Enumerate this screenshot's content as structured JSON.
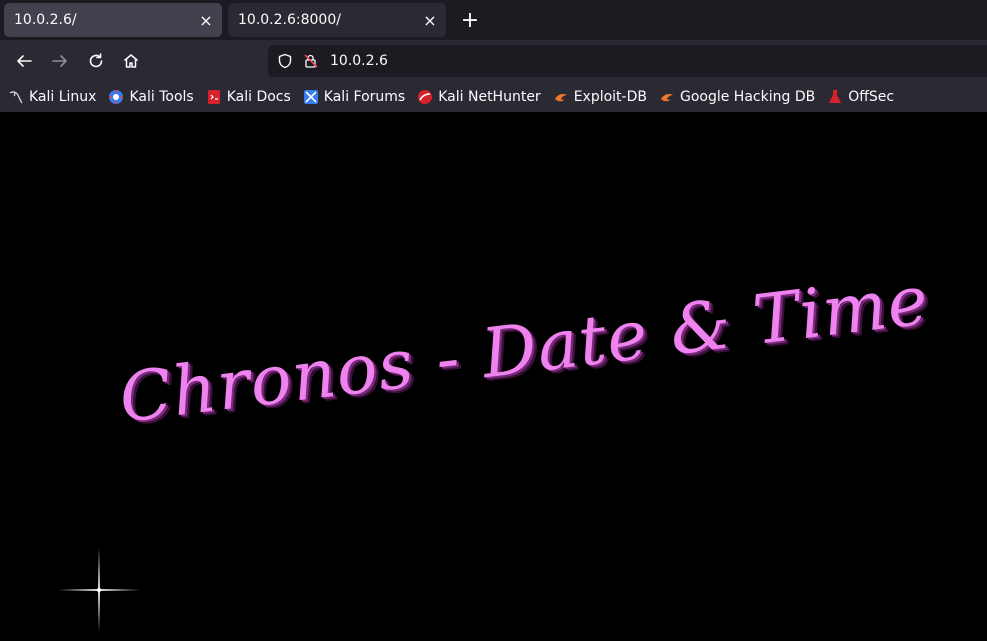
{
  "tabs": [
    {
      "title": "10.0.2.6/",
      "active": true
    },
    {
      "title": "10.0.2.6:8000/",
      "active": false
    }
  ],
  "new_tab_label": "+",
  "close_glyph": "×",
  "url": "10.0.2.6",
  "icons": {
    "back": "arrow-left-icon",
    "forward": "arrow-right-icon",
    "reload": "reload-icon",
    "home": "home-icon",
    "shield": "shield-icon",
    "insecure_lock": "lock-warning-icon"
  },
  "bookmarks": [
    {
      "label": "Kali Linux",
      "icon": "kali-dragon-icon"
    },
    {
      "label": "Kali Tools",
      "icon": "kali-tools-icon"
    },
    {
      "label": "Kali Docs",
      "icon": "kali-docs-icon"
    },
    {
      "label": "Kali Forums",
      "icon": "kali-forums-icon"
    },
    {
      "label": "Kali NetHunter",
      "icon": "kali-nethunter-icon"
    },
    {
      "label": "Exploit-DB",
      "icon": "exploit-db-icon"
    },
    {
      "label": "Google Hacking DB",
      "icon": "ghdb-icon"
    },
    {
      "label": "OffSec",
      "icon": "offsec-icon"
    }
  ],
  "page": {
    "heading": "Chronos - Date & Time",
    "heading_color": "#ee82ee"
  },
  "colors": {
    "tabstrip": "#1c1b22",
    "toolbar": "#2b2a33",
    "active_tab": "#42414d",
    "urlbar": "#1c1b22"
  }
}
